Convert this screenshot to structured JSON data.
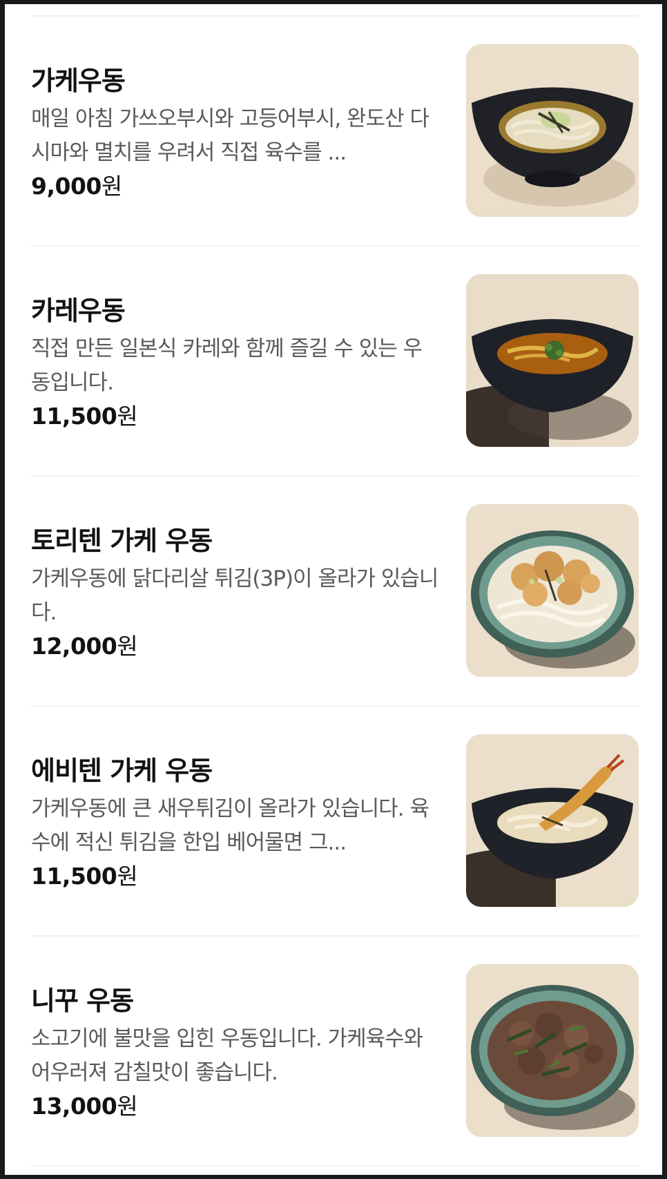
{
  "menu": {
    "items": [
      {
        "name": "가케우동",
        "description": "매일 아침 가쓰오부시와 고등어부시, 완도산 다시마와 멸치를 우려서 직접 육수를 ...",
        "price": "9,000",
        "currency": "원",
        "photo": "kake-udon-photo",
        "bowl_color": "#1c1e22"
      },
      {
        "name": "카레우동",
        "description": "직접 만든 일본식 카레와 함께 즐길 수 있는 우동입니다.",
        "price": "11,500",
        "currency": "원",
        "photo": "curry-udon-photo",
        "bowl_color": "#1c1e22"
      },
      {
        "name": "토리텐 가케 우동",
        "description": "가케우동에 닭다리살 튀김(3P)이 올라가 있습니다.",
        "price": "12,000",
        "currency": "원",
        "photo": "toriten-kake-udon-photo",
        "bowl_color": "#4e7a6e"
      },
      {
        "name": "에비텐 가케 우동",
        "description": "가케우동에 큰 새우튀김이 올라가 있습니다. 육수에 적신 튀김을 한입 베어물면 그...",
        "price": "11,500",
        "currency": "원",
        "photo": "ebiten-kake-udon-photo",
        "bowl_color": "#1c1e22"
      },
      {
        "name": "니꾸 우동",
        "description": "소고기에 불맛을 입힌 우동입니다. 가케육수와 어우러져 감칠맛이 좋습니다.",
        "price": "13,000",
        "currency": "원",
        "photo": "niku-udon-photo",
        "bowl_color": "#4e7a6e"
      }
    ]
  }
}
